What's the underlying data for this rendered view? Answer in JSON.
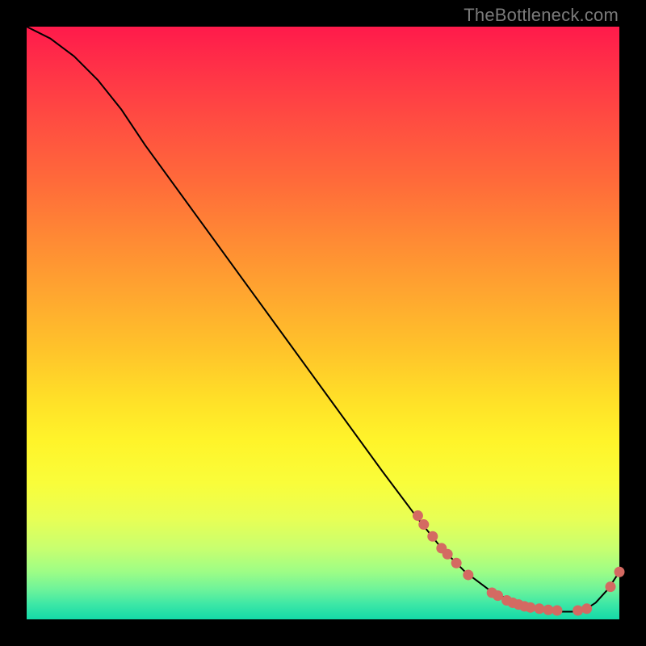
{
  "watermark": "TheBottleneck.com",
  "chart_data": {
    "type": "line",
    "title": "",
    "xlabel": "",
    "ylabel": "",
    "xlim": [
      0,
      100
    ],
    "ylim": [
      0,
      100
    ],
    "grid": false,
    "legend": false,
    "series": [
      {
        "name": "curve",
        "color": "#000000",
        "x": [
          0,
          4,
          8,
          12,
          16,
          20,
          28,
          36,
          44,
          52,
          60,
          66,
          70,
          74,
          78,
          82,
          86,
          88,
          90,
          92,
          94,
          96,
          98,
          100
        ],
        "y": [
          100,
          98,
          95,
          91,
          86,
          80,
          69,
          58,
          47,
          36,
          25,
          17,
          12,
          8,
          5,
          3,
          2,
          1.5,
          1.3,
          1.3,
          1.5,
          2.8,
          5.0,
          8.0
        ]
      }
    ],
    "markers": [
      {
        "name": "cluster",
        "color": "#d46a62",
        "radius": 6.5,
        "points": [
          {
            "x": 66.0,
            "y": 17.5
          },
          {
            "x": 67.0,
            "y": 16.0
          },
          {
            "x": 68.5,
            "y": 14.0
          },
          {
            "x": 70.0,
            "y": 12.0
          },
          {
            "x": 71.0,
            "y": 11.0
          },
          {
            "x": 72.5,
            "y": 9.5
          },
          {
            "x": 74.5,
            "y": 7.5
          },
          {
            "x": 78.5,
            "y": 4.5
          },
          {
            "x": 79.5,
            "y": 4.0
          },
          {
            "x": 81.0,
            "y": 3.2
          },
          {
            "x": 82.0,
            "y": 2.8
          },
          {
            "x": 83.0,
            "y": 2.5
          },
          {
            "x": 84.0,
            "y": 2.2
          },
          {
            "x": 85.0,
            "y": 2.0
          },
          {
            "x": 86.5,
            "y": 1.8
          },
          {
            "x": 88.0,
            "y": 1.6
          },
          {
            "x": 89.5,
            "y": 1.5
          },
          {
            "x": 93.0,
            "y": 1.5
          },
          {
            "x": 94.5,
            "y": 1.8
          },
          {
            "x": 98.5,
            "y": 5.5
          },
          {
            "x": 100.0,
            "y": 8.0
          }
        ]
      }
    ]
  }
}
